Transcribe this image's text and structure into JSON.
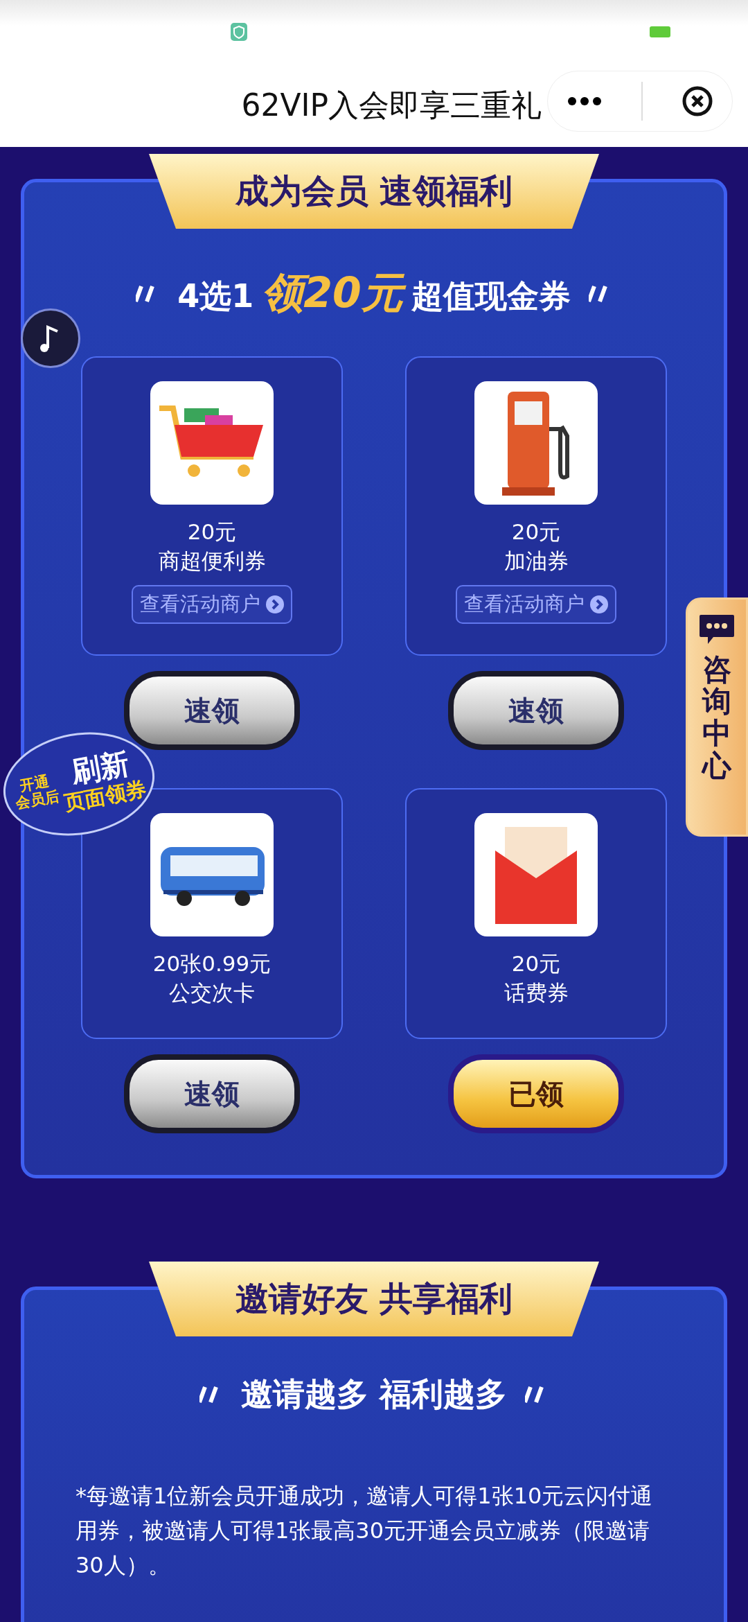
{
  "title_bar": {
    "title": "62VIP入会即享三重礼"
  },
  "section_1": {
    "banner": "成为会员 速领福利",
    "subtitle": {
      "prefix": "4选1",
      "highlight": "领20元",
      "suffix": "超值现金券"
    },
    "coupons": [
      {
        "kind": "cart",
        "amount": "20元",
        "name": "商超便利券",
        "link": "查看活动商户",
        "button": "速领",
        "claimed": false
      },
      {
        "kind": "fuel",
        "amount": "20元",
        "name": "加油券",
        "link": "查看活动商户",
        "button": "速领",
        "claimed": false
      },
      {
        "kind": "bus",
        "amount": "20张0.99元",
        "name": "公交次卡",
        "button": "速领",
        "claimed": false
      },
      {
        "kind": "phone",
        "amount": "20元",
        "name": "话费券",
        "button": "已领",
        "claimed": true
      }
    ]
  },
  "refresh_badge": {
    "line_1": "开通",
    "line_2": "会员后",
    "big": "刷新",
    "line_3": "页面领券"
  },
  "consult_tab": {
    "label": "咨询中心"
  },
  "section_2": {
    "banner": "邀请好友 共享福利",
    "subtitle": "邀请越多 福利越多",
    "note": "*每邀请1位新会员开通成功，邀请人可得1张10元云闪付通用券，被邀请人可得1张最高30元开通会员立减券（限邀请30人）。"
  }
}
